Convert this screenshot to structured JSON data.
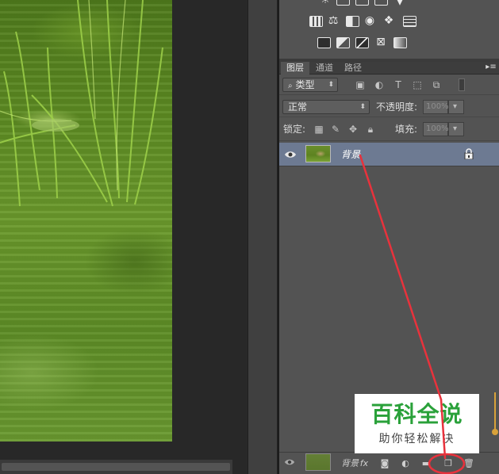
{
  "canvas": {
    "image_description": ""
  },
  "layers_panel": {
    "tabs": [
      "图层",
      "通道",
      "路径"
    ],
    "filter": {
      "label": "类型"
    },
    "blend_mode": {
      "value": "正常"
    },
    "opacity": {
      "label": "不透明度:",
      "value": "100%"
    },
    "lock": {
      "label": "锁定:"
    },
    "fill": {
      "label": "填充:",
      "value": "100%"
    },
    "layers": [
      {
        "name": "背景",
        "visible": true,
        "locked": true
      }
    ],
    "footer_layer_name": "背景"
  },
  "watermark": {
    "title": "百科全说",
    "subtitle": "助你轻松解决"
  },
  "colors": {
    "panel_bg": "#535353",
    "selected_layer": "#6d7a92",
    "annotation_red": "#e8323c",
    "watermark_green": "#2aa13a"
  }
}
